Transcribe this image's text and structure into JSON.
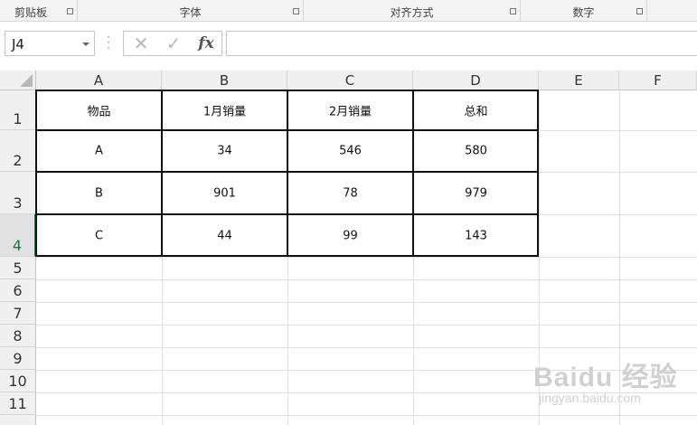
{
  "ribbon": {
    "groups": [
      {
        "label": "剪贴板"
      },
      {
        "label": "字体"
      },
      {
        "label": "对齐方式"
      },
      {
        "label": "数字"
      }
    ]
  },
  "formula_bar": {
    "name_box": "J4",
    "cancel_icon": "✕",
    "enter_icon": "✓",
    "fx_label": "fx",
    "formula": ""
  },
  "sheet": {
    "columns": [
      "A",
      "B",
      "C",
      "D",
      "E",
      "F"
    ],
    "rows": [
      "1",
      "2",
      "3",
      "4",
      "5",
      "6",
      "7",
      "8",
      "9",
      "10",
      "11"
    ],
    "active_row": "4",
    "active_cell": "J4",
    "table": {
      "headers": [
        "物品",
        "1月销量",
        "2月销量",
        "总和"
      ],
      "rows": [
        [
          "A",
          "34",
          "546",
          "580"
        ],
        [
          "B",
          "901",
          "78",
          "979"
        ],
        [
          "C",
          "44",
          "99",
          "143"
        ]
      ]
    }
  },
  "watermark": {
    "line1": "Baidu 经验",
    "line2": "jingyan.baidu.com"
  },
  "colors": {
    "active_row_accent": "#217346",
    "header_bg": "#f0f0f0",
    "table_border": "#111111"
  }
}
